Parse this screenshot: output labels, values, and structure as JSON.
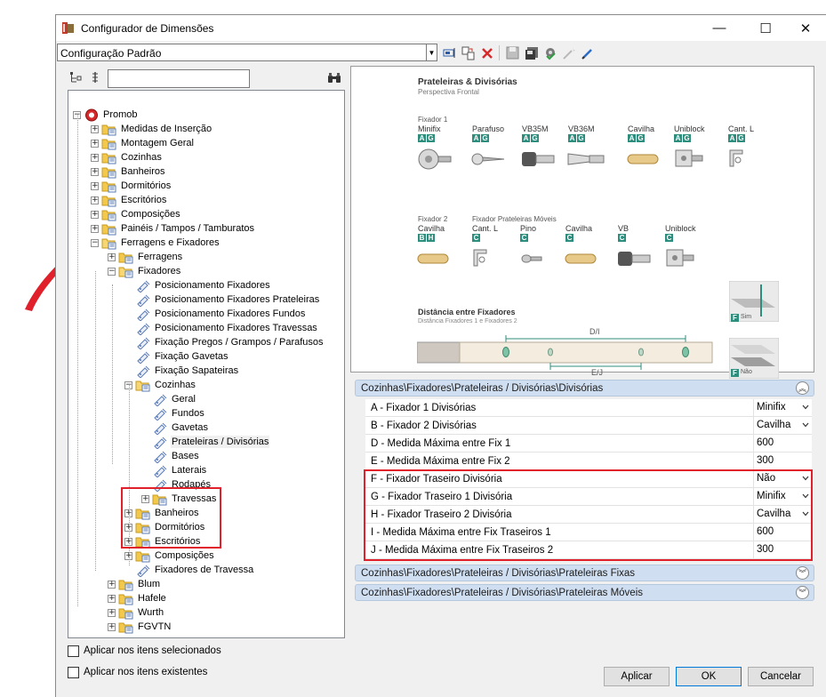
{
  "window": {
    "title": "Configurador de Dimensões",
    "minimize_glyph": "—",
    "maximize_glyph": "☐",
    "close_glyph": "✕"
  },
  "toolbar": {
    "config_selected": "Configuração Padrão",
    "icons": [
      "rename-icon",
      "copy-config-icon",
      "delete-icon",
      "save-icon",
      "save-as-icon",
      "apply-config-icon",
      "wand-icon",
      "edit-icon"
    ]
  },
  "left_tools": {
    "search_placeholder": "",
    "search_value": ""
  },
  "tree": {
    "root": "Promob",
    "level1": [
      "Medidas de Inserção",
      "Montagem Geral",
      "Cozinhas",
      "Banheiros",
      "Dormitórios",
      "Escritórios",
      "Composições",
      "Painéis / Tampos / Tamburatos",
      "Ferragens e Fixadores"
    ],
    "ferragens": "Ferragens",
    "fixadores": "Fixadores",
    "fixadores_items": [
      "Posicionamento Fixadores",
      "Posicionamento Fixadores Prateleiras",
      "Posicionamento Fixadores Fundos",
      "Posicionamento Fixadores Travessas",
      "Fixação Pregos / Grampos / Parafusos",
      "Fixação Gavetas",
      "Fixação Sapateiras"
    ],
    "cozinhas": "Cozinhas",
    "cozinhas_items": [
      "Geral",
      "Fundos",
      "Gavetas",
      "Prateleiras / Divisórias",
      "Bases",
      "Laterais",
      "Rodapés"
    ],
    "travessas": "Travessas",
    "fix_folders": [
      "Banheiros",
      "Dormitórios",
      "Escritórios",
      "Composições"
    ],
    "fixadores_travessa": "Fixadores de Travessa",
    "bottom": [
      "Blum",
      "Hafele",
      "Wurth",
      "FGVTN"
    ]
  },
  "preview": {
    "title": "Prateleiras & Divisórias",
    "subtitle": "Perspectiva Frontal",
    "fixador1": "Fixador 1",
    "row1": [
      {
        "name": "Minifix",
        "badge": [
          "A",
          "G"
        ]
      },
      {
        "name": "Parafuso",
        "badge": [
          "A",
          "G"
        ]
      },
      {
        "name": "VB35M",
        "badge": [
          "A",
          "G"
        ]
      },
      {
        "name": "VB36M",
        "badge": [
          "A",
          "G"
        ]
      },
      {
        "name": "Cavilha",
        "badge": [
          "A",
          "G"
        ]
      },
      {
        "name": "Uniblock",
        "badge": [
          "A",
          "G"
        ]
      },
      {
        "name": "Cant. L",
        "badge": [
          "A",
          "G"
        ]
      }
    ],
    "fixador2": "Fixador 2",
    "fix_moveis": "Fixador Prateleiras Móveis",
    "row2": [
      {
        "name": "Cavilha",
        "badge": [
          "B",
          "H"
        ]
      },
      {
        "name": "Cant. L",
        "badge": [
          "C"
        ]
      },
      {
        "name": "Pino",
        "badge": [
          "C"
        ]
      },
      {
        "name": "Cavilha",
        "badge": [
          "C"
        ]
      },
      {
        "name": "VB",
        "badge": [
          "C"
        ]
      },
      {
        "name": "Uniblock",
        "badge": [
          "C"
        ]
      }
    ],
    "dist_title": "Distância entre Fixadores",
    "dist_sub": "Distância Fixadores 1 e Fixadores 2",
    "dim_d": "D/I",
    "dim_e": "E/J",
    "f_badge": "F",
    "sim": "Sim",
    "nao": "Não"
  },
  "section_main": {
    "title": "Cozinhas\\Fixadores\\Prateleiras / Divisórias\\Divisórias",
    "toggle": "︽"
  },
  "properties": [
    {
      "label": "A - Fixador 1 Divisórias",
      "value": "Minifix",
      "dropdown": true
    },
    {
      "label": "B - Fixador 2 Divisórias",
      "value": "Cavilha",
      "dropdown": true
    },
    {
      "label": "D - Medida Máxima entre Fix 1",
      "value": "600",
      "dropdown": false
    },
    {
      "label": "E - Medida Máxima entre Fix 2",
      "value": "300",
      "dropdown": false
    },
    {
      "label": "F - Fixador Traseiro Divisória",
      "value": "Não",
      "dropdown": true
    },
    {
      "label": "G - Fixador Traseiro 1 Divisória",
      "value": "Minifix",
      "dropdown": true
    },
    {
      "label": "H - Fixador Traseiro 2 Divisória",
      "value": "Cavilha",
      "dropdown": true
    },
    {
      "label": "I - Medida Máxima entre Fix Traseiros 1",
      "value": "600",
      "dropdown": false
    },
    {
      "label": "J - Medida Máxima entre Fix Traseiros 2",
      "value": "300",
      "dropdown": false
    }
  ],
  "section_fixas": {
    "title": "Cozinhas\\Fixadores\\Prateleiras / Divisórias\\Prateleiras Fixas",
    "toggle": "︾"
  },
  "section_moveis": {
    "title": "Cozinhas\\Fixadores\\Prateleiras / Divisórias\\Prateleiras Móveis",
    "toggle": "︾"
  },
  "options": {
    "apply_selected": "Aplicar nos itens selecionados",
    "apply_existing": "Aplicar nos itens existentes"
  },
  "buttons": {
    "apply": "Aplicar",
    "ok": "OK",
    "cancel": "Cancelar"
  },
  "colors": {
    "annotation_red": "#e0202a",
    "badge_teal": "#2d8e7e",
    "section_blue": "#cfdef0"
  }
}
